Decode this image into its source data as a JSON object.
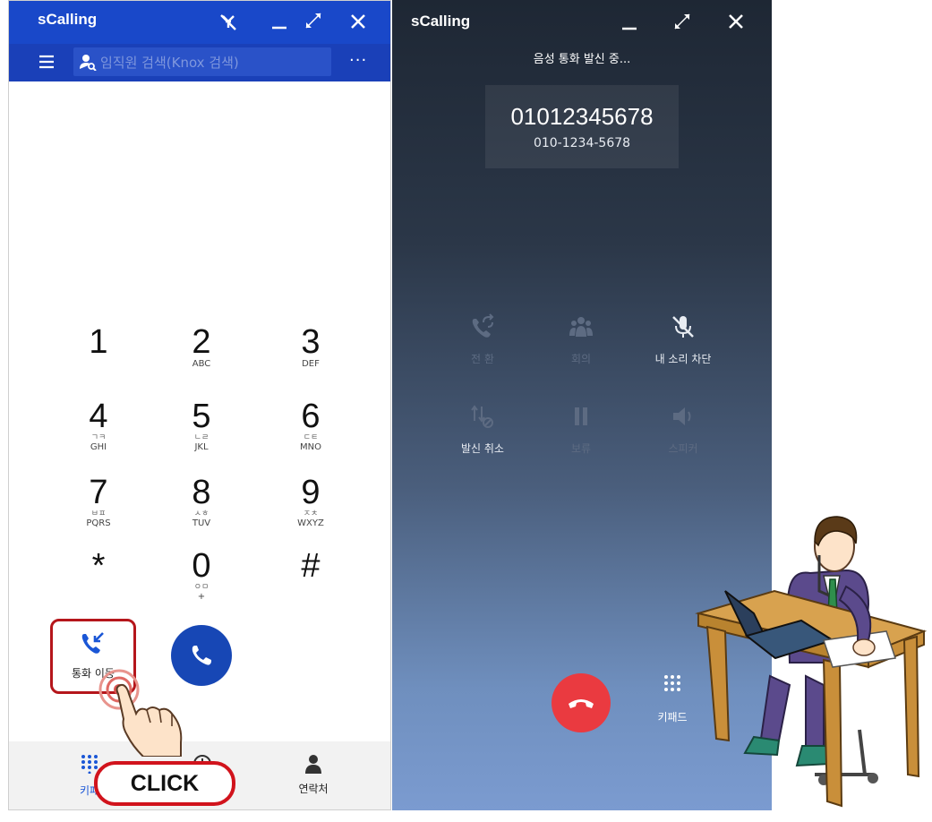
{
  "dialer_window": {
    "app_title": "sCalling",
    "search_placeholder": "임직원 검색(Knox 검색)",
    "keypad": [
      {
        "digit": "1",
        "kor": "",
        "letters": ""
      },
      {
        "digit": "2",
        "kor": "",
        "letters": "ABC"
      },
      {
        "digit": "3",
        "kor": "",
        "letters": "DEF"
      },
      {
        "digit": "4",
        "kor": "ㄱㅋ",
        "letters": "GHI"
      },
      {
        "digit": "5",
        "kor": "ㄴㄹ",
        "letters": "JKL"
      },
      {
        "digit": "6",
        "kor": "ㄷㅌ",
        "letters": "MNO"
      },
      {
        "digit": "7",
        "kor": "ㅂㅍ",
        "letters": "PQRS"
      },
      {
        "digit": "8",
        "kor": "ㅅㅎ",
        "letters": "TUV"
      },
      {
        "digit": "9",
        "kor": "ㅈㅊ",
        "letters": "WXYZ"
      },
      {
        "digit": "*",
        "kor": "",
        "letters": ""
      },
      {
        "digit": "0",
        "kor": "ㅇㅁ",
        "letters": "+"
      },
      {
        "digit": "#",
        "kor": "",
        "letters": ""
      }
    ],
    "call_forward_label": "통화 이동",
    "bottom_nav": {
      "keypad_label": "키패",
      "contacts_label": "연락처"
    }
  },
  "annotation": {
    "click_label": "CLICK",
    "highlight_color": "#c0161a"
  },
  "calling_window": {
    "app_title": "sCalling",
    "status": "음성 통화 발신 중...",
    "number_raw": "01012345678",
    "number_formatted": "010-1234-5678",
    "actions": [
      {
        "label": "전 환",
        "icon": "transfer-icon",
        "enabled": false
      },
      {
        "label": "회의",
        "icon": "conference-icon",
        "enabled": false
      },
      {
        "label": "내 소리 차단",
        "icon": "mute-icon",
        "enabled": true
      },
      {
        "label": "발신 취소",
        "icon": "cancel-call-icon",
        "enabled": true
      },
      {
        "label": "보류",
        "icon": "hold-icon",
        "enabled": false
      },
      {
        "label": "스피커",
        "icon": "speaker-icon",
        "enabled": false
      }
    ],
    "keypad_label": "키패드"
  },
  "colors": {
    "titlebar": "#1948c9",
    "call_button": "#1747b5",
    "end_call": "#ea3a40"
  }
}
